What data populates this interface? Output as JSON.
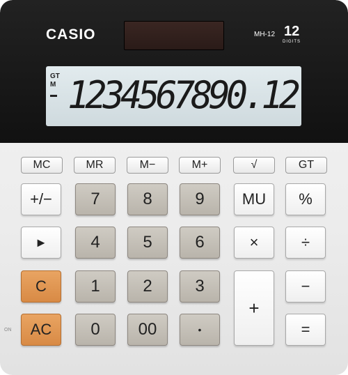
{
  "brand": "CASIO",
  "model": "MH-12",
  "digits_count": "12",
  "digits_label": "DIGITS",
  "display": {
    "indicator_gt": "GT",
    "indicator_m": "M",
    "readout": "1234567890.12"
  },
  "function_keys": [
    "MC",
    "MR",
    "M−",
    "M+",
    "√",
    "GT"
  ],
  "keys": {
    "plus_minus": "+/−",
    "seven": "7",
    "eight": "8",
    "nine": "9",
    "mu": "MU",
    "percent": "%",
    "arrow": "►",
    "four": "4",
    "five": "5",
    "six": "6",
    "multiply": "×",
    "divide": "÷",
    "clear": "C",
    "one": "1",
    "two": "2",
    "three": "3",
    "minus": "−",
    "all_clear": "AC",
    "zero": "0",
    "double_zero": "00",
    "decimal": "•",
    "plus": "+",
    "equals": "="
  },
  "on_label": "ON"
}
